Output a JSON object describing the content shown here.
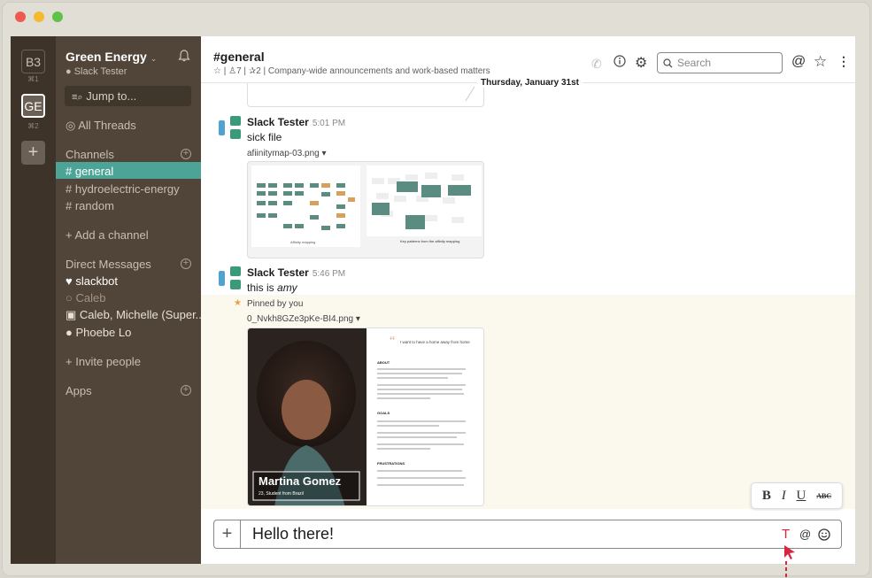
{
  "window_dots": [
    "#ee5a50",
    "#f5b92d",
    "#5fc148"
  ],
  "teams": [
    {
      "abbr": "B3",
      "shortcut": "⌘1"
    },
    {
      "abbr": "GE",
      "shortcut": "⌘2"
    }
  ],
  "sidebar": {
    "workspace": "Green Energy",
    "user": "Slack Tester",
    "jump": "Jump to...",
    "all_threads": "All Threads",
    "channels_header": "Channels",
    "channels": [
      "# general",
      "# hydroelectric-energy",
      "# random"
    ],
    "add_channel": "+ Add a channel",
    "dm_header": "Direct Messages",
    "dms": [
      "♥ slackbot",
      "○ Caleb",
      "▣ Caleb, Michelle (Super...",
      "● Phoebe Lo"
    ],
    "invite": "+ Invite people",
    "apps_header": "Apps"
  },
  "channel": {
    "title": "#general",
    "members": "7",
    "pins": "2",
    "topic": "Company-wide announcements and work-based matters",
    "search_placeholder": "Search"
  },
  "date_divider": "Thursday, January 31st",
  "messages": [
    {
      "sender": "Slack Tester",
      "time": "5:01 PM",
      "text": "sick file",
      "file": "afiinitymap-03.png ▾",
      "captions": [
        "Affinity mapping",
        "Key patterns from the affinity mapping"
      ]
    },
    {
      "sender": "Slack Tester",
      "time": "5:46 PM",
      "text_prefix": "this is ",
      "text_em": "amy",
      "pinned": "Pinned by you",
      "file": "0_Nvkh8GZe3pKe-BI4.png ▾",
      "persona_name": "Martina Gomez",
      "persona_sub": "23, Student from Brazil",
      "persona_quote": "I want to have a home away from home",
      "persona_sections": [
        "ABOUT",
        "GOALS",
        "FRUSTRATIONS"
      ]
    }
  ],
  "composer": {
    "text": "Hello there!"
  },
  "format_buttons": [
    "B",
    "I",
    "U",
    "ABC"
  ],
  "colors": {
    "accent": "#4ca497",
    "sidebar": "#504538",
    "rail": "#3d3328",
    "cursor": "#d7263d"
  }
}
